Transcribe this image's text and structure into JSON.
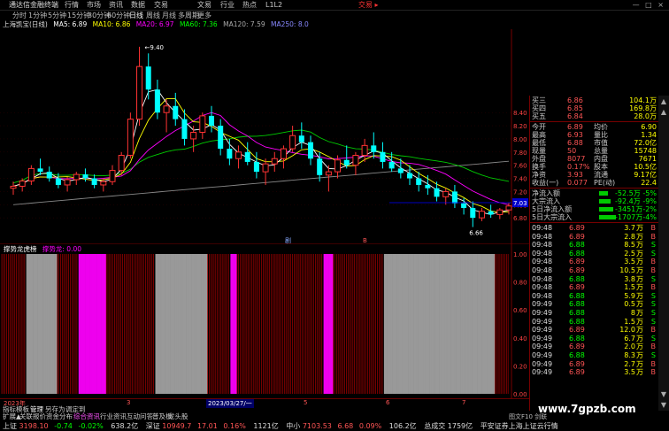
{
  "menubar": {
    "app_title": "通达信金融终端",
    "items": [
      "行情",
      "市场",
      "资讯",
      "数据",
      "交易",
      "文易",
      "行业",
      "热点",
      "L1L2"
    ],
    "trade_btn": "交易 ▸",
    "window_controls": "— □ ×"
  },
  "toolbar": {
    "items": [
      "分时",
      "1分钟",
      "5分钟",
      "15分钟",
      "30分钟",
      "60分钟",
      "日线",
      "周线",
      "月线",
      "多周期",
      "更多"
    ],
    "active_index": 6
  },
  "stockline": {
    "name": "上海凯宝(日线)",
    "ma5": "MA5: 6.89",
    "ma10": "MA10: 6.86",
    "ma20": "MA20: 6.97",
    "ma60": "MA60: 7.36",
    "ma120": "MA120: 7.59",
    "ma250": "MA250: 8.0",
    "colors": {
      "ma5": "#ffffff",
      "ma10": "#ffff00",
      "ma20": "#ff00ff",
      "ma60": "#00ff00",
      "ma120": "#888888",
      "ma250": "#8888ff"
    }
  },
  "chart_data": {
    "type": "candlestick",
    "y_ticks": [
      "8.40",
      "8.20",
      "8.00",
      "7.80",
      "7.60",
      "7.40",
      "7.20",
      "7.00",
      "6.80"
    ],
    "ylim": [
      6.6,
      9.6
    ],
    "high_label": "9.40",
    "low_label": "6.66",
    "current_price_tag": "7.03",
    "bottom_markers": [
      "剧",
      "B"
    ],
    "candles": [
      [
        7.25,
        7.35,
        7.15,
        7.28
      ],
      [
        7.28,
        7.4,
        7.2,
        7.36
      ],
      [
        7.36,
        7.6,
        7.3,
        7.55
      ],
      [
        7.55,
        7.7,
        7.45,
        7.5
      ],
      [
        7.5,
        7.58,
        7.35,
        7.4
      ],
      [
        7.4,
        7.48,
        7.25,
        7.3
      ],
      [
        7.3,
        7.42,
        7.2,
        7.38
      ],
      [
        7.38,
        7.5,
        7.3,
        7.46
      ],
      [
        7.46,
        7.55,
        7.35,
        7.4
      ],
      [
        7.4,
        7.46,
        7.25,
        7.3
      ],
      [
        7.3,
        7.4,
        7.2,
        7.35
      ],
      [
        7.35,
        7.6,
        7.3,
        7.52
      ],
      [
        7.52,
        7.8,
        7.45,
        7.75
      ],
      [
        7.75,
        8.4,
        7.7,
        8.3
      ],
      [
        8.3,
        9.4,
        8.2,
        9.1
      ],
      [
        9.1,
        9.3,
        8.6,
        8.75
      ],
      [
        8.75,
        8.9,
        8.3,
        8.4
      ],
      [
        8.4,
        8.6,
        8.1,
        8.5
      ],
      [
        8.5,
        8.7,
        8.2,
        8.3
      ],
      [
        8.3,
        8.45,
        7.9,
        8.0
      ],
      [
        8.0,
        8.2,
        7.8,
        8.1
      ],
      [
        8.1,
        8.4,
        8.0,
        8.35
      ],
      [
        8.35,
        8.5,
        8.1,
        8.2
      ],
      [
        8.2,
        8.3,
        7.75,
        7.85
      ],
      [
        7.85,
        8.0,
        7.6,
        7.7
      ],
      [
        7.7,
        7.9,
        7.55,
        7.8
      ],
      [
        7.8,
        7.95,
        7.6,
        7.65
      ],
      [
        7.65,
        7.8,
        7.4,
        7.5
      ],
      [
        7.5,
        7.7,
        7.3,
        7.62
      ],
      [
        7.62,
        7.8,
        7.5,
        7.7
      ],
      [
        7.7,
        7.9,
        7.55,
        7.85
      ],
      [
        7.85,
        8.2,
        7.8,
        8.05
      ],
      [
        8.05,
        8.25,
        7.85,
        7.95
      ],
      [
        7.95,
        8.05,
        7.6,
        7.7
      ],
      [
        7.7,
        7.8,
        7.35,
        7.45
      ],
      [
        7.45,
        7.6,
        7.2,
        7.5
      ],
      [
        7.5,
        7.75,
        7.4,
        7.68
      ],
      [
        7.68,
        7.9,
        7.55,
        7.6
      ],
      [
        7.6,
        7.8,
        7.45,
        7.75
      ],
      [
        7.75,
        8.0,
        7.65,
        7.9
      ],
      [
        7.9,
        8.1,
        7.7,
        7.8
      ],
      [
        7.8,
        7.95,
        7.55,
        7.65
      ],
      [
        7.65,
        7.8,
        7.5,
        7.55
      ],
      [
        7.55,
        7.7,
        7.4,
        7.48
      ],
      [
        7.48,
        7.6,
        7.3,
        7.4
      ],
      [
        7.4,
        7.5,
        7.2,
        7.3
      ],
      [
        7.3,
        7.45,
        7.15,
        7.25
      ],
      [
        7.25,
        7.35,
        7.05,
        7.12
      ],
      [
        7.12,
        7.25,
        7.0,
        7.2
      ],
      [
        7.2,
        7.3,
        6.95,
        7.02
      ],
      [
        7.02,
        7.1,
        6.85,
        6.95
      ],
      [
        6.95,
        7.05,
        6.66,
        6.8
      ],
      [
        6.8,
        6.95,
        6.75,
        6.9
      ],
      [
        6.9,
        7.0,
        6.8,
        6.85
      ],
      [
        6.85,
        6.95,
        6.78,
        6.92
      ],
      [
        6.92,
        7.03,
        6.85,
        6.98
      ]
    ]
  },
  "indicator": {
    "title": "撑势龙虎榜",
    "param": "撑势龙: 0.00",
    "y_ticks": [
      "1.00",
      "0.80",
      "0.60",
      "0.40",
      "0.20",
      "0.00"
    ],
    "bars": "RRRRRRRRRRRRRRRGGGGGGGGGGGGGGGGGGGRRRRRRRRRRRRRMMMMMMMMMMMMMMMMMRRRRRRRRRRRRRRRRRRRRRRRRRRRRRRGGGGGGGGGGGGGGGGGGGGGGGGGGGGGGGGRRRRRRRRRRRRRRMMMMRRRRRRRRRRRRRRRRRRRRRRRRRRRRRRRRRRRRRRRRRRRRRRRRRRRRRMMMMMMRRRRRRRRRRRRRRRRRRRRRRRRRRRRRRRGGGGGGGGGGGGGGGGGGGGGGGGGGGGGGGGGGGGGGGGGGGGGGGGGGGGGGGGGGGGGGGGGGGGRRRRRRRRR"
  },
  "datebar": {
    "labels": [
      "2023年",
      "3",
      "2023/03/27/一",
      "5",
      "6",
      "7"
    ],
    "selected": "2023/03/27/一"
  },
  "bottomtabs": [
    "指标",
    "模板",
    "管理",
    "另存为",
    "调定到"
  ],
  "bottomtabs2": [
    "扩展▲",
    "关联报价",
    "资金分布",
    "综合资讯",
    "行业资讯",
    "互动问答",
    "普及板",
    "龙头股"
  ],
  "right_panel": {
    "quote_rows": [
      {
        "label": "买三",
        "price": "6.86",
        "vol": "104.1万"
      },
      {
        "label": "买四",
        "price": "6.85",
        "vol": "169.8万"
      },
      {
        "label": "买五",
        "price": "6.84",
        "vol": "28.0万"
      }
    ],
    "stats": [
      {
        "l1": "今开",
        "v1": "6.89",
        "l2": "均价",
        "v2": "6.90"
      },
      {
        "l1": "最高",
        "v1": "6.93",
        "l2": "量比",
        "v2": "1.34"
      },
      {
        "l1": "最低",
        "v1": "6.88",
        "l2": "市值",
        "v2": "72.0亿"
      },
      {
        "l1": "现量",
        "v1": "50",
        "l2": "总量",
        "v2": "15748"
      },
      {
        "l1": "外盘",
        "v1": "8077",
        "l2": "内盘",
        "v2": "7671"
      },
      {
        "l1": "换手",
        "v1": "0.17%",
        "l2": "股本",
        "v2": "10.5亿"
      },
      {
        "l1": "净资",
        "v1": "3.93",
        "l2": "流通",
        "v2": "9.17亿"
      },
      {
        "l1": "收益(一)",
        "v1": "0.077",
        "l2": "PE(动)",
        "v2": "22.4"
      }
    ],
    "flows": [
      {
        "label": "净流入额",
        "val": "-52.5万",
        "pct": "-5%"
      },
      {
        "label": "大宗流入",
        "val": "-92.4万",
        "pct": "-9%"
      },
      {
        "label": "5日净流入额",
        "val": "-3451万",
        "pct": "-2%"
      },
      {
        "label": "5日大宗流入",
        "val": "-1707万",
        "pct": "-4%"
      }
    ],
    "ticks": [
      {
        "t": "09:48",
        "p": "6.89",
        "v": "3.7",
        "d": "B"
      },
      {
        "t": "09:48",
        "p": "6.89",
        "v": "2.8",
        "d": "B"
      },
      {
        "t": "09:48",
        "p": "6.88",
        "v": "8.5",
        "d": "S"
      },
      {
        "t": "09:48",
        "p": "6.88",
        "v": "2.5",
        "d": "S"
      },
      {
        "t": "09:48",
        "p": "6.89",
        "v": "3.5",
        "d": "B"
      },
      {
        "t": "09:48",
        "p": "6.89",
        "v": "10.5",
        "d": "B"
      },
      {
        "t": "09:48",
        "p": "6.88",
        "v": "3.8",
        "d": "S"
      },
      {
        "t": "09:48",
        "p": "6.89",
        "v": "1.5",
        "d": "B"
      },
      {
        "t": "09:48",
        "p": "6.88",
        "v": "5.9",
        "d": "S"
      },
      {
        "t": "09:49",
        "p": "6.88",
        "v": "0.5",
        "d": "S"
      },
      {
        "t": "09:49",
        "p": "6.88",
        "v": "8",
        "d": "S"
      },
      {
        "t": "09:49",
        "p": "6.88",
        "v": "1.5",
        "d": "S"
      },
      {
        "t": "09:49",
        "p": "6.89",
        "v": "12.0",
        "d": "B"
      },
      {
        "t": "09:49",
        "p": "6.88",
        "v": "6.7",
        "d": "S"
      },
      {
        "t": "09:49",
        "p": "6.89",
        "v": "2.0",
        "d": "B"
      },
      {
        "t": "09:49",
        "p": "6.88",
        "v": "8.3",
        "d": "S"
      },
      {
        "t": "09:49",
        "p": "6.89",
        "v": "2.7",
        "d": "B"
      },
      {
        "t": "09:49",
        "p": "6.89",
        "v": "3.5",
        "d": "B"
      }
    ]
  },
  "statusbar": {
    "sh_label": "上证",
    "sh_val": "3198.10",
    "sh_chg": "-0.74",
    "sh_pct": "-0.02%",
    "sh_amt": "638.2亿",
    "sz_label": "深证",
    "sz_val": "10949.7",
    "sz_chg": "17.01",
    "sz_pct": "0.16%",
    "sz_amt": "1121亿",
    "zx_label": "中小",
    "zx_val": "7103.53",
    "zx_chg": "6.68",
    "zx_pct": "0.09%",
    "zx_amt": "106.2亿",
    "total_label": "总成交",
    "total_val": "1759亿",
    "broker": "平安证券上海上证云行情"
  },
  "watermark": "www.7gpzb.com",
  "pager": "图文F10 剑联"
}
